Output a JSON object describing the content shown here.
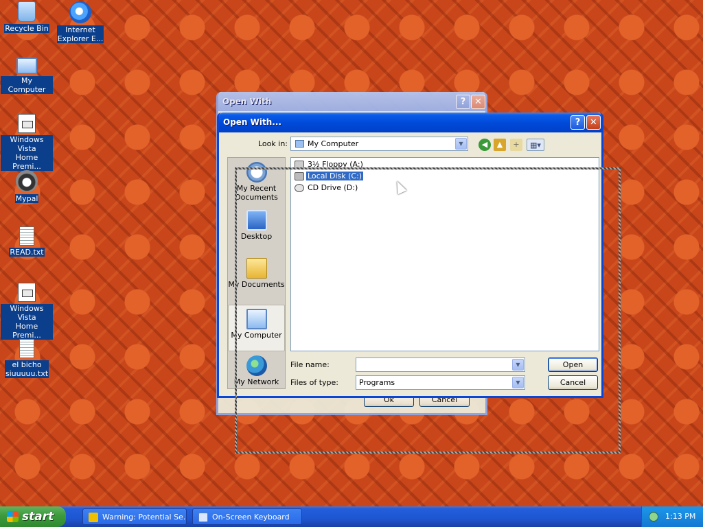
{
  "desktop": {
    "icons": [
      {
        "label": "Recycle Bin",
        "icon": "recycle-bin-icon"
      },
      {
        "label": "Internet\nExplorer E...",
        "icon": "internet-explorer-icon"
      },
      {
        "label": "My Computer",
        "icon": "my-computer-icon"
      },
      {
        "label": "Windows Vista\nHome Premi...",
        "icon": "document-icon"
      },
      {
        "label": "Mypal",
        "icon": "mypal-icon"
      },
      {
        "label": "READ.txt",
        "icon": "text-file-icon"
      },
      {
        "label": "Windows Vista\nHome Premi...",
        "icon": "document-icon"
      },
      {
        "label": "el bicho\nsiuuuuu.txt",
        "icon": "text-file-icon"
      }
    ]
  },
  "back_window": {
    "title": "Open With",
    "ok_label": "Ok",
    "cancel_label": "Cancel"
  },
  "dialog": {
    "title": "Open With...",
    "help_glyph": "?",
    "close_glyph": "✕",
    "look_in_label": "Look in:",
    "look_in_value": "My Computer",
    "places": [
      {
        "label": "My Recent\nDocuments",
        "icon": "recent-documents-icon"
      },
      {
        "label": "Desktop",
        "icon": "desktop-icon"
      },
      {
        "label": "My Documents",
        "icon": "my-documents-icon"
      },
      {
        "label": "My Computer",
        "icon": "my-computer-icon"
      },
      {
        "label": "My Network",
        "icon": "my-network-icon"
      }
    ],
    "files": [
      {
        "name": "3½ Floppy (A:)",
        "icon": "floppy-drive-icon"
      },
      {
        "name": "Local Disk (C:)",
        "icon": "hard-disk-icon",
        "selected": true
      },
      {
        "name": "CD Drive (D:)",
        "icon": "cd-drive-icon"
      }
    ],
    "file_name_label": "File name:",
    "file_name_value": "",
    "files_of_type_label": "Files of type:",
    "files_of_type_value": "Programs",
    "open_label": "Open",
    "cancel_label": "Cancel"
  },
  "taskbar": {
    "start_label": "start",
    "tasks": [
      {
        "label": "Warning: Potential Se...",
        "icon": "warning-icon"
      },
      {
        "label": "On-Screen Keyboard",
        "icon": "keyboard-icon"
      }
    ],
    "clock": "1:13 PM"
  },
  "colors": {
    "desktop_bg": "#c8461a",
    "title_blue": "#0049d8",
    "selection": "#316ac5",
    "taskbar_blue": "#245edb",
    "start_green": "#3c9a3c"
  }
}
